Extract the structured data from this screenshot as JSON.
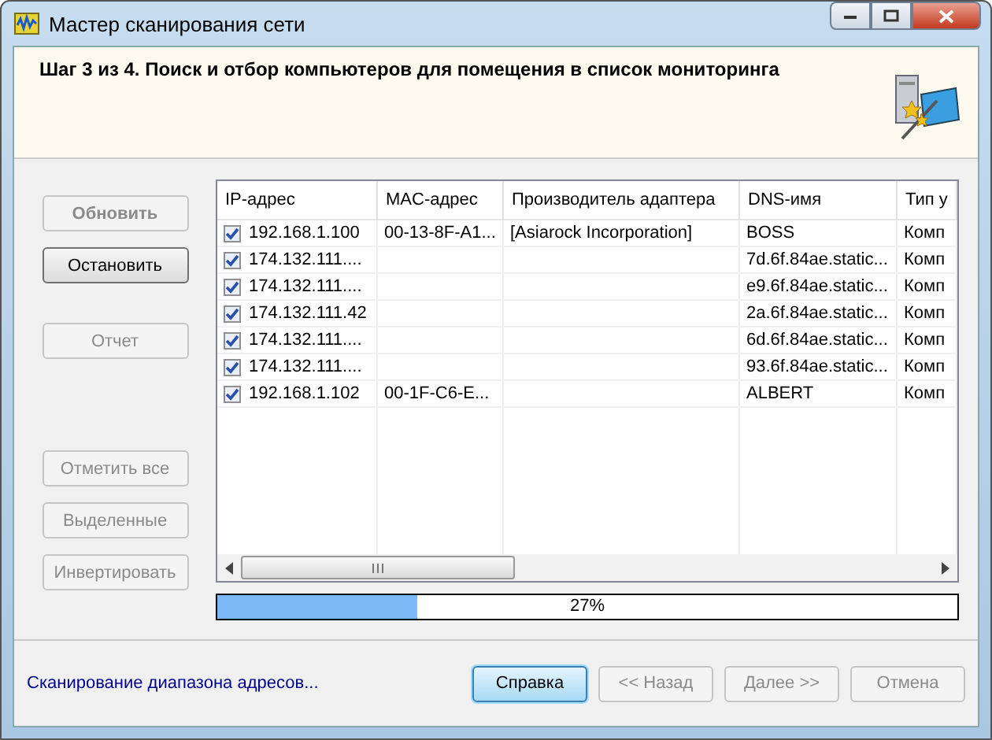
{
  "window": {
    "title": "Мастер сканирования сети"
  },
  "header": {
    "step": "Шаг 3 из 4. Поиск и отбор компьютеров для помещения в список мониторинга"
  },
  "side_button_groups": [
    [
      {
        "label": "Обновить",
        "disabled": true,
        "default": true
      },
      {
        "label": "Остановить",
        "disabled": false,
        "default": false
      }
    ],
    [
      {
        "label": "Отчет",
        "disabled": true,
        "default": false
      }
    ],
    [
      {
        "label": "Отметить все",
        "disabled": true,
        "default": false
      },
      {
        "label": "Выделенные",
        "disabled": true,
        "default": false
      },
      {
        "label": "Инвертировать",
        "disabled": true,
        "default": false
      }
    ]
  ],
  "table": {
    "columns": [
      "IP-адрес",
      "MAC-адрес",
      "Производитель адаптера",
      "DNS-имя",
      "Тип у"
    ],
    "rows": [
      {
        "checked": true,
        "cells": [
          "192.168.1.100",
          "00-13-8F-A1...",
          "[Asiarock Incorporation]",
          "BOSS",
          "Комп"
        ]
      },
      {
        "checked": true,
        "cells": [
          "174.132.111....",
          "",
          "",
          "7d.6f.84ae.static...",
          "Комп"
        ]
      },
      {
        "checked": true,
        "cells": [
          "174.132.111....",
          "",
          "",
          "e9.6f.84ae.static...",
          "Комп"
        ]
      },
      {
        "checked": true,
        "cells": [
          "174.132.111.42",
          "",
          "",
          "2a.6f.84ae.static...",
          "Комп"
        ]
      },
      {
        "checked": true,
        "cells": [
          "174.132.111....",
          "",
          "",
          "6d.6f.84ae.static...",
          "Комп"
        ]
      },
      {
        "checked": true,
        "cells": [
          "174.132.111....",
          "",
          "",
          "93.6f.84ae.static...",
          "Комп"
        ]
      },
      {
        "checked": true,
        "cells": [
          "192.168.1.102",
          "00-1F-C6-E...",
          "",
          "ALBERT",
          "Комп"
        ]
      }
    ]
  },
  "progress": {
    "level": 0.27,
    "reading": "27%"
  },
  "status": "Сканирование диапазона адресов...",
  "footer_buttons": [
    {
      "label": "Справка",
      "disabled": false,
      "default": true
    },
    {
      "label": "<< Назад",
      "disabled": true,
      "default": false
    },
    {
      "label": "Далее >>",
      "disabled": true,
      "default": false
    },
    {
      "label": "Отмена",
      "disabled": true,
      "default": false
    }
  ]
}
